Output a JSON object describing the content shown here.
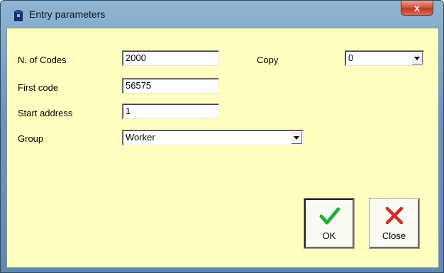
{
  "window": {
    "title": "Entry parameters",
    "close_label": "x"
  },
  "form": {
    "codes_label": "N. of Codes",
    "codes_value": "2000",
    "first_code_label": "First code",
    "first_code_value": "56575",
    "start_address_label": "Start address",
    "start_address_value": "1",
    "group_label": "Group",
    "group_value": "Worker",
    "copy_label": "Copy",
    "copy_value": "0"
  },
  "buttons": {
    "ok_label": "OK",
    "close_label": "Close"
  },
  "colors": {
    "client_bg": "#ffffc0",
    "ok_check": "#1fae3a",
    "close_x": "#d32a2a"
  },
  "icons": {
    "app": "app-icon",
    "ok": "check-icon",
    "close": "x-icon"
  }
}
